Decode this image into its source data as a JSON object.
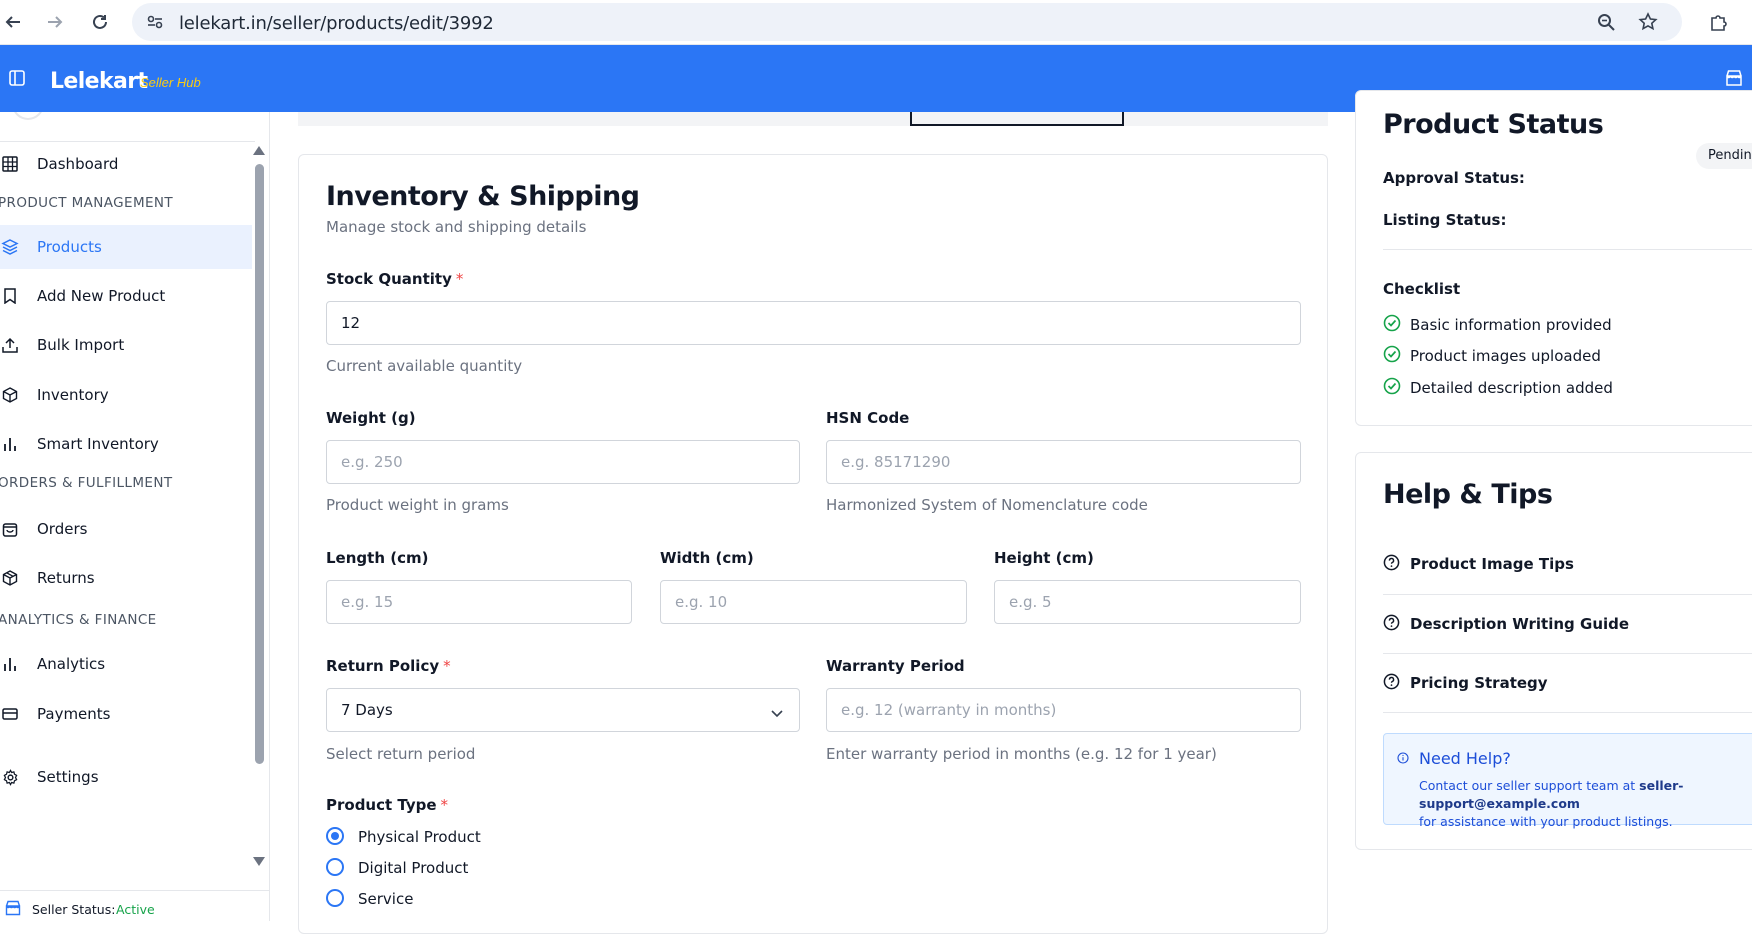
{
  "browser": {
    "url": "lelekart.in/seller/products/edit/3992"
  },
  "app": {
    "brand": "Lelekart",
    "brand_sub": "Seller Hub"
  },
  "sidebar": {
    "items": [
      {
        "label": "Dashboard",
        "icon": "grid-icon"
      },
      {
        "label": "Products",
        "icon": "layers-icon",
        "active": true
      },
      {
        "label": "Add New Product",
        "icon": "bookmark-icon"
      },
      {
        "label": "Bulk Import",
        "icon": "upload-icon"
      },
      {
        "label": "Inventory",
        "icon": "box-icon"
      },
      {
        "label": "Smart Inventory",
        "icon": "bar-chart-icon"
      },
      {
        "label": "Orders",
        "icon": "shopping-bag-icon"
      },
      {
        "label": "Returns",
        "icon": "package-icon"
      },
      {
        "label": "Analytics",
        "icon": "bar-chart-icon"
      },
      {
        "label": "Payments",
        "icon": "credit-card-icon"
      },
      {
        "label": "Settings",
        "icon": "gear-icon"
      }
    ],
    "sections": {
      "product_management": "PRODUCT MANAGEMENT",
      "orders_fulfillment": "ORDERS & FULFILLMENT",
      "analytics_finance": "ANALYTICS & FINANCE"
    },
    "seller_status_label": "Seller Status:",
    "seller_status_value": "Active"
  },
  "inventory": {
    "title": "Inventory & Shipping",
    "subtitle": "Manage stock and shipping details",
    "stock_label": "Stock Quantity",
    "stock_value": "12",
    "stock_help": "Current available quantity",
    "weight_label": "Weight (g)",
    "weight_placeholder": "e.g. 250",
    "weight_help": "Product weight in grams",
    "hsn_label": "HSN Code",
    "hsn_placeholder": "e.g. 85171290",
    "hsn_help": "Harmonized System of Nomenclature code",
    "length_label": "Length (cm)",
    "length_placeholder": "e.g. 15",
    "width_label": "Width (cm)",
    "width_placeholder": "e.g. 10",
    "height_label": "Height (cm)",
    "height_placeholder": "e.g. 5",
    "return_label": "Return Policy",
    "return_value": "7 Days",
    "return_help": "Select return period",
    "warranty_label": "Warranty Period",
    "warranty_placeholder": "e.g. 12 (warranty in months)",
    "warranty_help": "Enter warranty period in months (e.g. 12 for 1 year)",
    "product_type_label": "Product Type",
    "product_types": [
      {
        "label": "Physical Product",
        "checked": true
      },
      {
        "label": "Digital Product",
        "checked": false
      },
      {
        "label": "Service",
        "checked": false
      }
    ],
    "required_mark": "*"
  },
  "status": {
    "title": "Product Status",
    "approval_label": "Approval Status:",
    "approval_value": "Pending",
    "listing_label": "Listing Status:",
    "checklist_label": "Checklist",
    "checklist": [
      "Basic information provided",
      "Product images uploaded",
      "Detailed description added"
    ]
  },
  "help": {
    "title": "Help & Tips",
    "items": [
      "Product Image Tips",
      "Description Writing Guide",
      "Pricing Strategy"
    ],
    "need_help_title": "Need Help?",
    "need_help_text_1": "Contact our seller support team at",
    "need_help_email": "seller-support@example.com",
    "need_help_text_2": "for assistance with your product listings."
  },
  "colors": {
    "brand_blue": "#2b76f5",
    "active_bg": "#eaf1fe",
    "success": "#16a34a",
    "required": "#ef4444"
  }
}
